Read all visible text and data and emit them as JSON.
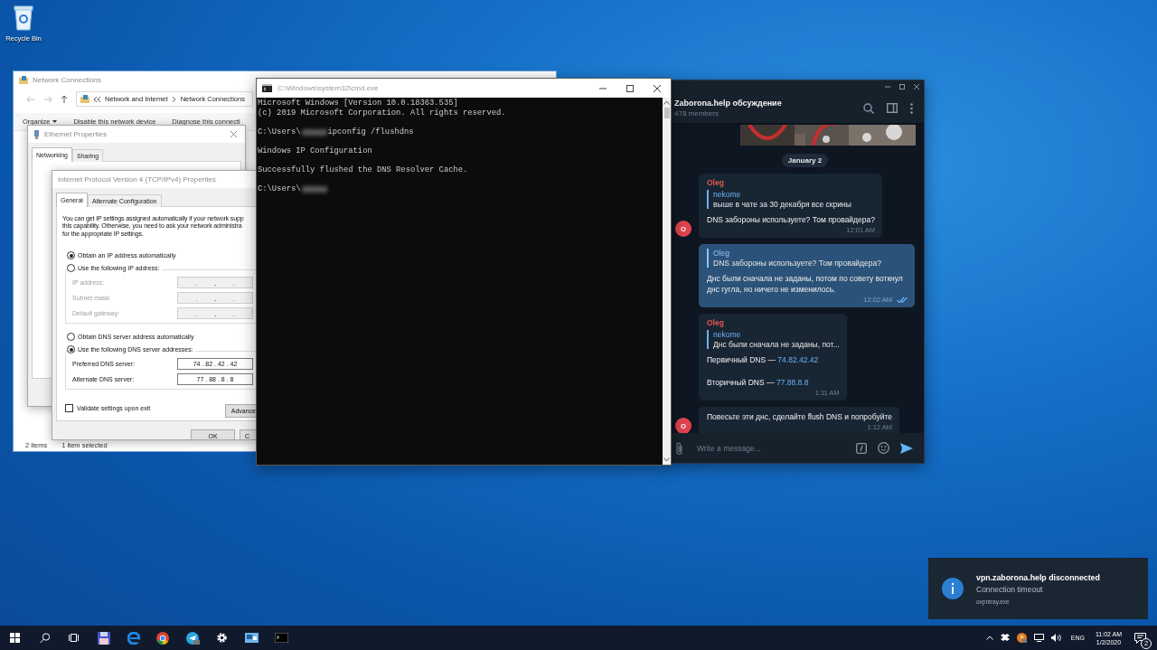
{
  "desktop_icons": [
    {
      "label": "Recycle Bin"
    }
  ],
  "network_connections": {
    "title": "Network Connections",
    "breadcrumb": [
      "Network and Internet",
      "Network Connections"
    ],
    "toolbar": [
      "Organize",
      "Disable this network device",
      "Diagnose this connecti"
    ],
    "status": [
      "2 items",
      "1 item selected"
    ]
  },
  "ethernet_properties": {
    "title": "Ethernet Properties",
    "tabs": [
      {
        "label": "Networking",
        "selected": true
      },
      {
        "label": "Sharing",
        "selected": false
      }
    ]
  },
  "ipv4_properties": {
    "title": "Internet Protocol Version 4 (TCP/IPv4) Properties",
    "tabs": [
      {
        "label": "General",
        "selected": true
      },
      {
        "label": "Alternate Configuration",
        "selected": false
      }
    ],
    "intro": "You can get IP settings assigned automatically if your network supp\nthis capability. Otherwise, you need to ask your network administra\nfor the appropriate IP settings.",
    "ip_choice": [
      {
        "label": "Obtain an IP address automatically",
        "selected": true
      },
      {
        "label": "Use the following IP address:",
        "selected": false
      }
    ],
    "ip_fields": [
      {
        "label": "IP address:",
        "disabled": true
      },
      {
        "label": "Subnet mask:",
        "disabled": true
      },
      {
        "label": "Default gateway:",
        "disabled": true
      }
    ],
    "dns_choice": [
      {
        "label": "Obtain DNS server address automatically",
        "selected": false
      },
      {
        "label": "Use the following DNS server addresses:",
        "selected": true
      }
    ],
    "dns_fields": [
      {
        "label": "Preferred DNS server:",
        "value": "74 . 82 . 42 . 42",
        "disabled": false
      },
      {
        "label": "Alternate DNS server:",
        "value": "77 . 88 . 8 . 8",
        "disabled": false
      }
    ],
    "validate": {
      "label": "Validate settings upon exit",
      "checked": false
    },
    "advanced_button": "Advance",
    "buttons": [
      "OK",
      "C"
    ]
  },
  "console": {
    "title": "C:\\Windows\\system32\\cmd.exe",
    "blocks": [
      [
        {
          "kind": "text",
          "text": "Microsoft Windows [Version 10.0.18363.535]"
        },
        {
          "kind": "text",
          "text": "(c) 2019 Microsoft Corporation. All rights reserved."
        }
      ],
      [
        {
          "kind": "prompt",
          "prompt": "C:\\Users\\",
          "redacted": true,
          "command": "ipconfig /flushdns"
        }
      ],
      [
        {
          "kind": "text",
          "text": "Windows IP Configuration"
        }
      ],
      [
        {
          "kind": "text",
          "text": "Successfully flushed the DNS Resolver Cache."
        }
      ],
      [
        {
          "kind": "prompt",
          "prompt": "C:\\Users\\",
          "redacted": true
        }
      ]
    ]
  },
  "telegram": {
    "chat_title": "Zaborona.help обсуждение",
    "members": "478 members",
    "date": "January 2",
    "messages": [
      {
        "kind": "incoming",
        "avatar": "O",
        "author": "Oleg",
        "reply": {
          "author": "nekome",
          "text": "выше в чате за 30 декабря все скрины"
        },
        "body": [
          {
            "text": "DNS забороны используете? Том провайдера?"
          }
        ],
        "time": "12:01 AM"
      },
      {
        "kind": "outgoing",
        "reply": {
          "author": "Oleg",
          "text": "DNS забороны используете? Том провайдера?"
        },
        "body": [
          {
            "text": "Днс были сначала не заданы, потом по совету воткнул днс гугла, но ничего не изменилось."
          }
        ],
        "time": "12:02 AM",
        "read": true
      },
      {
        "kind": "incoming",
        "author": "Oleg",
        "reply": {
          "author": "nekome",
          "text": "Днс были сначала не заданы, пот..."
        },
        "body": [
          {
            "text": "Первичный DNS — ",
            "link": "74.82.42.42"
          },
          {
            "text": "Вторичный DNS — ",
            "link": "77.88.8.8"
          }
        ],
        "time": "1:11 AM"
      },
      {
        "kind": "incoming",
        "avatar": "O",
        "body": [
          {
            "text": "Повесьте эти днс, сделайте flush DNS и попробуйте"
          }
        ],
        "time": "1:12 AM"
      }
    ],
    "placeholder": "Write a message..."
  },
  "notification": {
    "title": "vpn.zaborona.help disconnected",
    "body": "Connection timeout",
    "source": "ovpntray.exe"
  },
  "taskbar": {
    "language": "ENG",
    "time": "11:02 AM",
    "date": "1/2/2020",
    "notifications": "2"
  }
}
